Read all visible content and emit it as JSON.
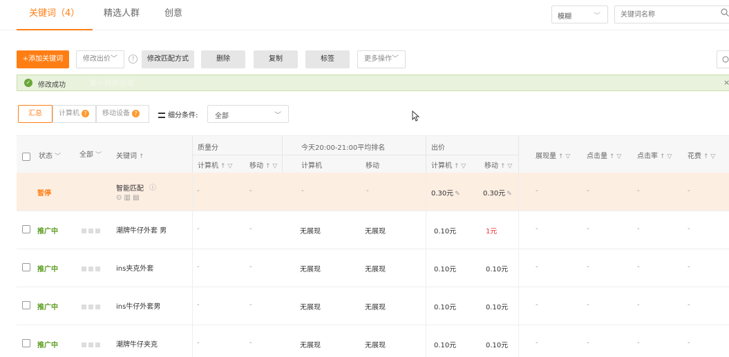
{
  "tabs": [
    {
      "label": "关键词（4）",
      "active": true
    },
    {
      "label": "精选人群",
      "active": false
    },
    {
      "label": "创意",
      "active": false
    }
  ],
  "search": {
    "match_mode": "模糊",
    "placeholder": "关键词名称",
    "search_icon": "search-icon"
  },
  "toolbar": {
    "add_keyword": "+添加关键词",
    "modify_bid": "修改出价",
    "modify_match": "修改匹配方式",
    "delete": "删除",
    "copy": "复制",
    "tag": "标签",
    "more_actions": "更多操作"
  },
  "alert": {
    "message": "修改成功",
    "ghost_text": "美小鲜的创客",
    "close": "×"
  },
  "segments": {
    "summary": "汇总",
    "computer": "计算机",
    "mobile": "移动设备"
  },
  "filter": {
    "label": "细分条件:",
    "value": "全部"
  },
  "table": {
    "headers": {
      "status": "状态",
      "all": "全部",
      "keyword": "关键词",
      "quality_score": "质量分",
      "ranking": "今天20:00-21:00平均排名",
      "bid": "出价",
      "computer": "计算机",
      "mobile": "移动",
      "impressions": "展现量",
      "clicks": "点击量",
      "ctr": "点击率",
      "cost": "花费"
    },
    "rows": [
      {
        "status": "暂停",
        "keyword": "智能匹配",
        "q_pc": "-",
        "q_mobile": "-",
        "rank_pc": "-",
        "rank_mobile": "-",
        "bid_pc": "0.30元",
        "bid_mobile": "0.30元",
        "impressions": "-",
        "clicks": "-",
        "ctr": "-",
        "cost": "-"
      },
      {
        "status": "推广中",
        "keyword": "潮牌牛仔外套 男",
        "q_pc": "-",
        "q_mobile": "-",
        "rank_pc": "无展现",
        "rank_mobile": "无展现",
        "bid_pc": "0.10元",
        "bid_mobile": "1元",
        "impressions": "-",
        "clicks": "-",
        "ctr": "-",
        "cost": "-"
      },
      {
        "status": "推广中",
        "keyword": "ins夹克外套",
        "q_pc": "-",
        "q_mobile": "-",
        "rank_pc": "无展现",
        "rank_mobile": "无展现",
        "bid_pc": "0.10元",
        "bid_mobile": "0.10元",
        "impressions": "-",
        "clicks": "-",
        "ctr": "-",
        "cost": "-"
      },
      {
        "status": "推广中",
        "keyword": "ins牛仔外套男",
        "q_pc": "-",
        "q_mobile": "-",
        "rank_pc": "无展现",
        "rank_mobile": "无展现",
        "bid_pc": "0.10元",
        "bid_mobile": "0.10元",
        "impressions": "-",
        "clicks": "-",
        "ctr": "-",
        "cost": "-"
      },
      {
        "status": "推广中",
        "keyword": "潮牌牛仔夹克",
        "q_pc": "-",
        "q_mobile": "-",
        "rank_pc": "无展现",
        "rank_mobile": "无展现",
        "bid_pc": "0.10元",
        "bid_mobile": "0.10元",
        "impressions": "-",
        "clicks": "-",
        "ctr": "-",
        "cost": "-"
      }
    ]
  },
  "colors": {
    "accent": "#ff7e14",
    "success_bg": "#e9f2dc",
    "status_active": "#5a9b1e",
    "alert_red": "#ee3333"
  }
}
